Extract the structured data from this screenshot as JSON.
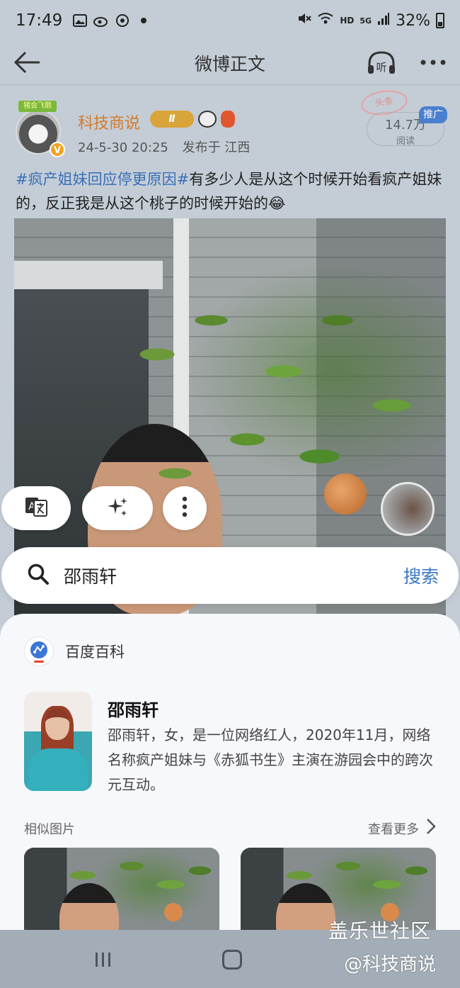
{
  "status_bar": {
    "time": "17:49",
    "network": "HD",
    "signal": "5G",
    "battery": "32%"
  },
  "nav": {
    "title": "微博正文",
    "listen_icon_text": "听"
  },
  "post": {
    "avatar_tag": "猪会飞鹅",
    "verified_mark": "V",
    "username": "科技商说",
    "level_badge": "Ⅱ",
    "date": "24-5-30 20:25",
    "location": "发布于 江西",
    "stamp": "头条",
    "views_count": "14.7万",
    "views_label": "阅读",
    "promo_badge": "推广",
    "hashtag": "#疯产姐妹回应停更原因#",
    "body": "有多少人是从这个时候开始看疯产姐妹的，反正我是从这个桃子的时候开始的😂"
  },
  "search": {
    "query": "邵雨轩",
    "action": "搜索"
  },
  "result": {
    "source": "百度百科",
    "title": "邵雨轩",
    "description": "邵雨轩，女，是一位网络红人，2020年11月，网络名称疯产姐妹与《赤狐书生》主演在游园会中的跨次元互动。",
    "similar_label": "相似图片",
    "see_more": "查看更多"
  },
  "watermark": {
    "line1": "盖乐世社区",
    "line2": "@科技商说"
  },
  "colors": {
    "accent_blue": "#3a76c6",
    "username_orange": "#d5792a",
    "hashtag_blue": "#3a70b8"
  },
  "icons": [
    "back-arrow-icon",
    "headphones-icon",
    "more-dots-icon",
    "translate-icon",
    "sparkle-icon",
    "vertical-dots-icon",
    "search-icon",
    "baidu-logo-icon",
    "chevron-right-icon",
    "recents-icon",
    "home-icon"
  ]
}
